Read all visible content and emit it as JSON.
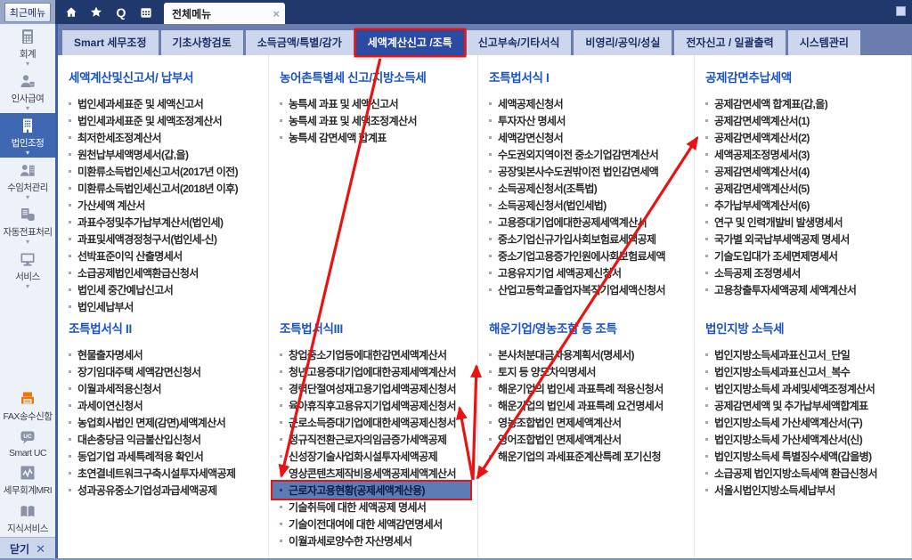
{
  "topbar": {
    "recent_menu_label": "최근메뉴",
    "quick_icons": [
      {
        "icon": "home-icon"
      },
      {
        "icon": "star-icon"
      },
      {
        "icon": "search-icon",
        "glyph": "Q"
      },
      {
        "icon": "calendar-icon"
      }
    ],
    "open_tab": {
      "label": "전체메뉴",
      "close_glyph": "×"
    }
  },
  "menu_tabs": [
    {
      "label": "Smart 세무조정",
      "selected": false
    },
    {
      "label": "기초사항검토",
      "selected": false
    },
    {
      "label": "소득금액/특별/감가",
      "selected": false
    },
    {
      "label": "세액계산신고 /조특",
      "selected": true
    },
    {
      "label": "신고부속/기타서식",
      "selected": false
    },
    {
      "label": "비영리/공익/성실",
      "selected": false
    },
    {
      "label": "전자신고 / 일괄출력",
      "selected": false
    },
    {
      "label": "시스템관리",
      "selected": false
    }
  ],
  "sidebar": {
    "top_items": [
      {
        "label": "회계",
        "icon": "calculator-icon",
        "selected": false
      },
      {
        "label": "인사급여",
        "icon": "person-payroll-icon",
        "selected": false
      },
      {
        "label": "법인조정",
        "icon": "building-icon",
        "selected": true
      },
      {
        "label": "수임처관리",
        "icon": "person-building-icon",
        "selected": false
      },
      {
        "label": "자동전표처리",
        "icon": "document-database-icon",
        "selected": false
      },
      {
        "label": "서비스",
        "icon": "monitor-icon",
        "selected": false
      }
    ],
    "bottom_items": [
      {
        "label": "FAX송수신함",
        "icon": "fax-icon"
      },
      {
        "label": "Smart UC",
        "icon": "uc-chat-icon"
      },
      {
        "label": "세무회계MRI",
        "icon": "chart-line-icon"
      },
      {
        "label": "지식서비스",
        "icon": "books-icon"
      }
    ],
    "close_label": "닫기",
    "close_glyph": "✕"
  },
  "sections": [
    {
      "title": "세액계산및신고서/ 납부서",
      "items": [
        "법인세과세표준 및 세액신고서",
        "법인세과세표준 및 세액조정계산서",
        "최저한세조정계산서",
        "원천납부세액명세서(갑,을)",
        "미환류소득법인세신고서(2017년 이전)",
        "미환류소득법인세신고서(2018년 이후)",
        "가산세액 계산서",
        "과표수정및추가납부계산서(법인세)",
        "과표및세액경정청구서(법인세-신)",
        "선박표준이익 산출명세서",
        "소급공제법인세액환급신청서",
        "법인세 중간예납신고서",
        "법인세납부서"
      ]
    },
    {
      "title": "농어촌특별세 신고/지방소득세",
      "items": [
        "농특세 과표 및 세액신고서",
        "농특세 과표 및 세액조정계산서",
        "농특세 감면세액 합계표"
      ]
    },
    {
      "title": "조특법서식 I",
      "items": [
        "세액공제신청서",
        "투자자산 명세서",
        "세액감면신청서",
        "수도권외지역이전 중소기업감면계산서",
        "공장및본사수도권밖이전 법인감면세액",
        "소득공제신청서(조특법)",
        "소득공제신청서(법인세법)",
        "고용증대기업에대한공제세액계산서",
        "중소기업신규가입사회보험료세액공제",
        "중소기업고용증가인원에사회보험료세액",
        "고용유지기업 세액공제신청서",
        "산업고등학교졸업자복직기업세액신청서"
      ]
    },
    {
      "title": "공제감면추납세액",
      "items": [
        "공제감면세액 합계표(갑,을)",
        "공제감면세액계산서(1)",
        "공제감면세액계산서(2)",
        "세액공제조정명세서(3)",
        "공제감면세액계산서(4)",
        "공제감면세액계산서(5)",
        "추가납부세액계산서(6)",
        "연구 및 인력개발비 발생명세서",
        "국가별 외국납부세액공제 명세서",
        "기술도입대가 조세면제명세서",
        "소득공제 조정명세서",
        "고용창출투자세액공제 세액계산서"
      ]
    },
    {
      "title": "조특법서식 II",
      "items": [
        "현물출자명세서",
        "장기임대주택 세액감면신청서",
        "이월과세적용신청서",
        "과세이연신청서",
        "농업회사법인 면제(감면)세액계산서",
        "대손충당금 익금불산입신청서",
        "동업기업 과세특례적용 확인서",
        "초연결네트워크구축시설투자세액공제",
        "성과공유중소기업성과급세액공제"
      ]
    },
    {
      "title": "조특법서식III",
      "highlight_index": 8,
      "items": [
        "창업중소기업등에대한감면세액계산서",
        "청년고용증대기업에대한공제세액계산서",
        "경력단절여성재고용기업세액공제신청서",
        "육아휴직후고용유지기업세액공제신청서",
        "근로소득증대기업에대한세액공제신청서",
        "정규직전환근로자의임금증가세액공제",
        "신성장기술사업화시설투자세액공제",
        "영상콘텐츠제작비용세액공제세액계산서",
        "근로자고용현황(공제세액계산용)",
        "기술취득에 대한 세액공제 명세서",
        "기술이전대여에 대한 세액감면명세서",
        "이월과세로양수한 자산명세서"
      ]
    },
    {
      "title": "해운기업/영농조합 등 조특",
      "items": [
        "본사처분대금사용계획서(명세서)",
        "토지 등 양도차익명세서",
        "해운기업의 법인세 과표특례 적용신청서",
        "해운기업의 법인세 과표특례 요건명세서",
        "영농조합법인 면제세액계산서",
        "영어조합법인 면제세액계산서",
        "해운기업의 과세표준계산특례 포기신청"
      ]
    },
    {
      "title": "법인지방 소득세",
      "items": [
        "법인지방소득세과표신고서_단일",
        "법인지방소득세과표신고서_복수",
        "법인지방소득세 과세및세액조정계산서",
        "공제감면세액 및 추가납부세액합계표",
        "법인지방소득세 가산세액계산서(구)",
        "법인지방소득세 가산세액계산서(신)",
        "법인지방소득세 특별징수세액(갑을병)",
        "소급공제 법인지방소득세액 환급신청서",
        "서울시법인지방소득세납부서"
      ]
    }
  ],
  "colors": {
    "accent_red": "#E81414",
    "selected_tab_bg": "#2B4AA2",
    "section_title_blue": "#1A53C4",
    "highlight_bg": "#5D7BB4",
    "topbar_navy": "#21386D",
    "fax_orange": "#E8760E"
  }
}
